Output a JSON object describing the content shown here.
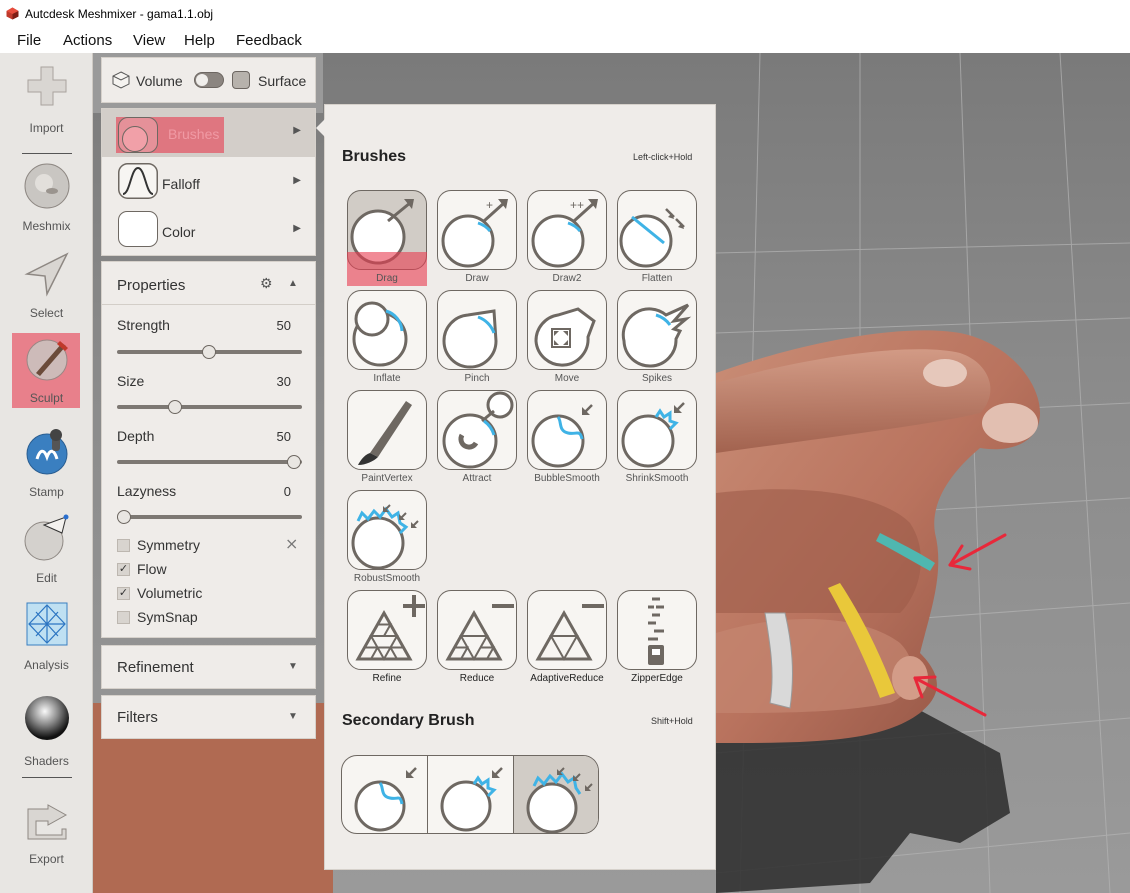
{
  "window": {
    "title": "Autcdesk Meshmixer - gama1.1.obj"
  },
  "menubar": {
    "items": [
      "File",
      "Actions",
      "View",
      "Help",
      "Feedback"
    ]
  },
  "toolbar": {
    "items": [
      {
        "label": "Import",
        "icon": "plus-icon"
      },
      {
        "label": "Meshmix",
        "icon": "bunny-sphere-icon"
      },
      {
        "label": "Select",
        "icon": "cursor-arrow-icon"
      },
      {
        "label": "Sculpt",
        "icon": "sculpt-brush-icon"
      },
      {
        "label": "Stamp",
        "icon": "stamp-icon"
      },
      {
        "label": "Edit",
        "icon": "edit-sphere-icon"
      },
      {
        "label": "Analysis",
        "icon": "analysis-mesh-icon"
      },
      {
        "label": "Shaders",
        "icon": "shader-sphere-icon"
      },
      {
        "label": "Export",
        "icon": "export-icon"
      }
    ]
  },
  "mode": {
    "volume": "Volume",
    "surface": "Surface"
  },
  "brush_menu": {
    "brushes": "Brushes",
    "falloff": "Falloff",
    "color": "Color"
  },
  "properties": {
    "title": "Properties",
    "strength": {
      "label": "Strength",
      "value": "50",
      "fraction": 0.5
    },
    "size": {
      "label": "Size",
      "value": "30",
      "fraction": 0.3
    },
    "depth": {
      "label": "Depth",
      "value": "50",
      "fraction": 1.0
    },
    "lazyness": {
      "label": "Lazyness",
      "value": "0",
      "fraction": 0.0
    },
    "symmetry": {
      "label": "Symmetry",
      "checked": false
    },
    "flow": {
      "label": "Flow",
      "checked": true
    },
    "volumetric": {
      "label": "Volumetric",
      "checked": true
    },
    "symsnap": {
      "label": "SymSnap",
      "checked": false
    }
  },
  "refinement": {
    "title": "Refinement"
  },
  "filters": {
    "title": "Filters"
  },
  "flyout": {
    "title": "Brushes",
    "hint": "Left-click+Hold",
    "brushes": [
      "Drag",
      "Draw",
      "Draw2",
      "Flatten",
      "Inflate",
      "Pinch",
      "Move",
      "Spikes",
      "PaintVertex",
      "Attract",
      "BubbleSmooth",
      "ShrinkSmooth",
      "RobustSmooth",
      "Refine",
      "Reduce",
      "AdaptiveReduce",
      "ZipperEdge"
    ],
    "selected": "Drag",
    "secondary_title": "Secondary Brush",
    "secondary_hint": "Shift+Hold"
  },
  "colors": {
    "accent_highlight": "#e83c50",
    "panel_bg": "#efece9",
    "brush_blue": "#3fb3e6"
  }
}
